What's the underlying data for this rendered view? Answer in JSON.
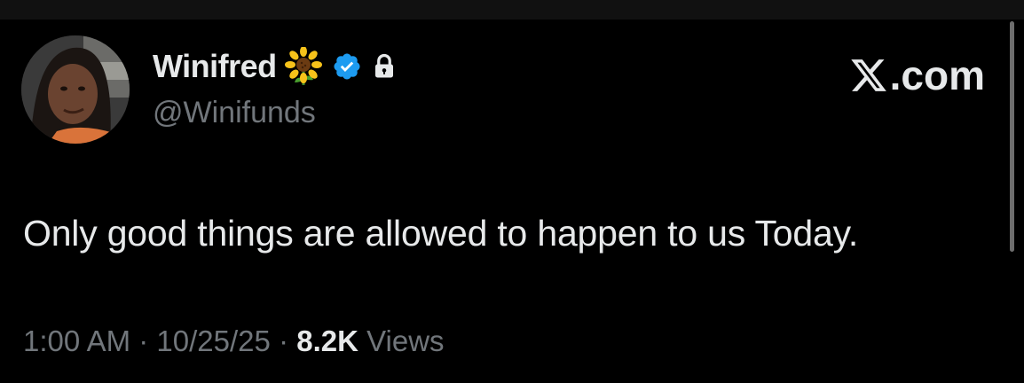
{
  "author": {
    "display_name": "Winifred",
    "name_emoji": "sunflower-icon",
    "verified": true,
    "protected": true,
    "handle": "@Winifunds"
  },
  "brand": {
    "label": ".com",
    "logo": "x-logo-icon"
  },
  "tweet": {
    "text": "Only good things are allowed to happen to us Today."
  },
  "meta": {
    "time": "1:00 AM",
    "separator": "·",
    "date": "10/25/25",
    "views_count": "8.2K",
    "views_label": "Views"
  },
  "colors": {
    "background": "#000000",
    "primary_text": "#e7e9ea",
    "secondary_text": "#71767b",
    "verified_blue": "#1d9bf0"
  }
}
